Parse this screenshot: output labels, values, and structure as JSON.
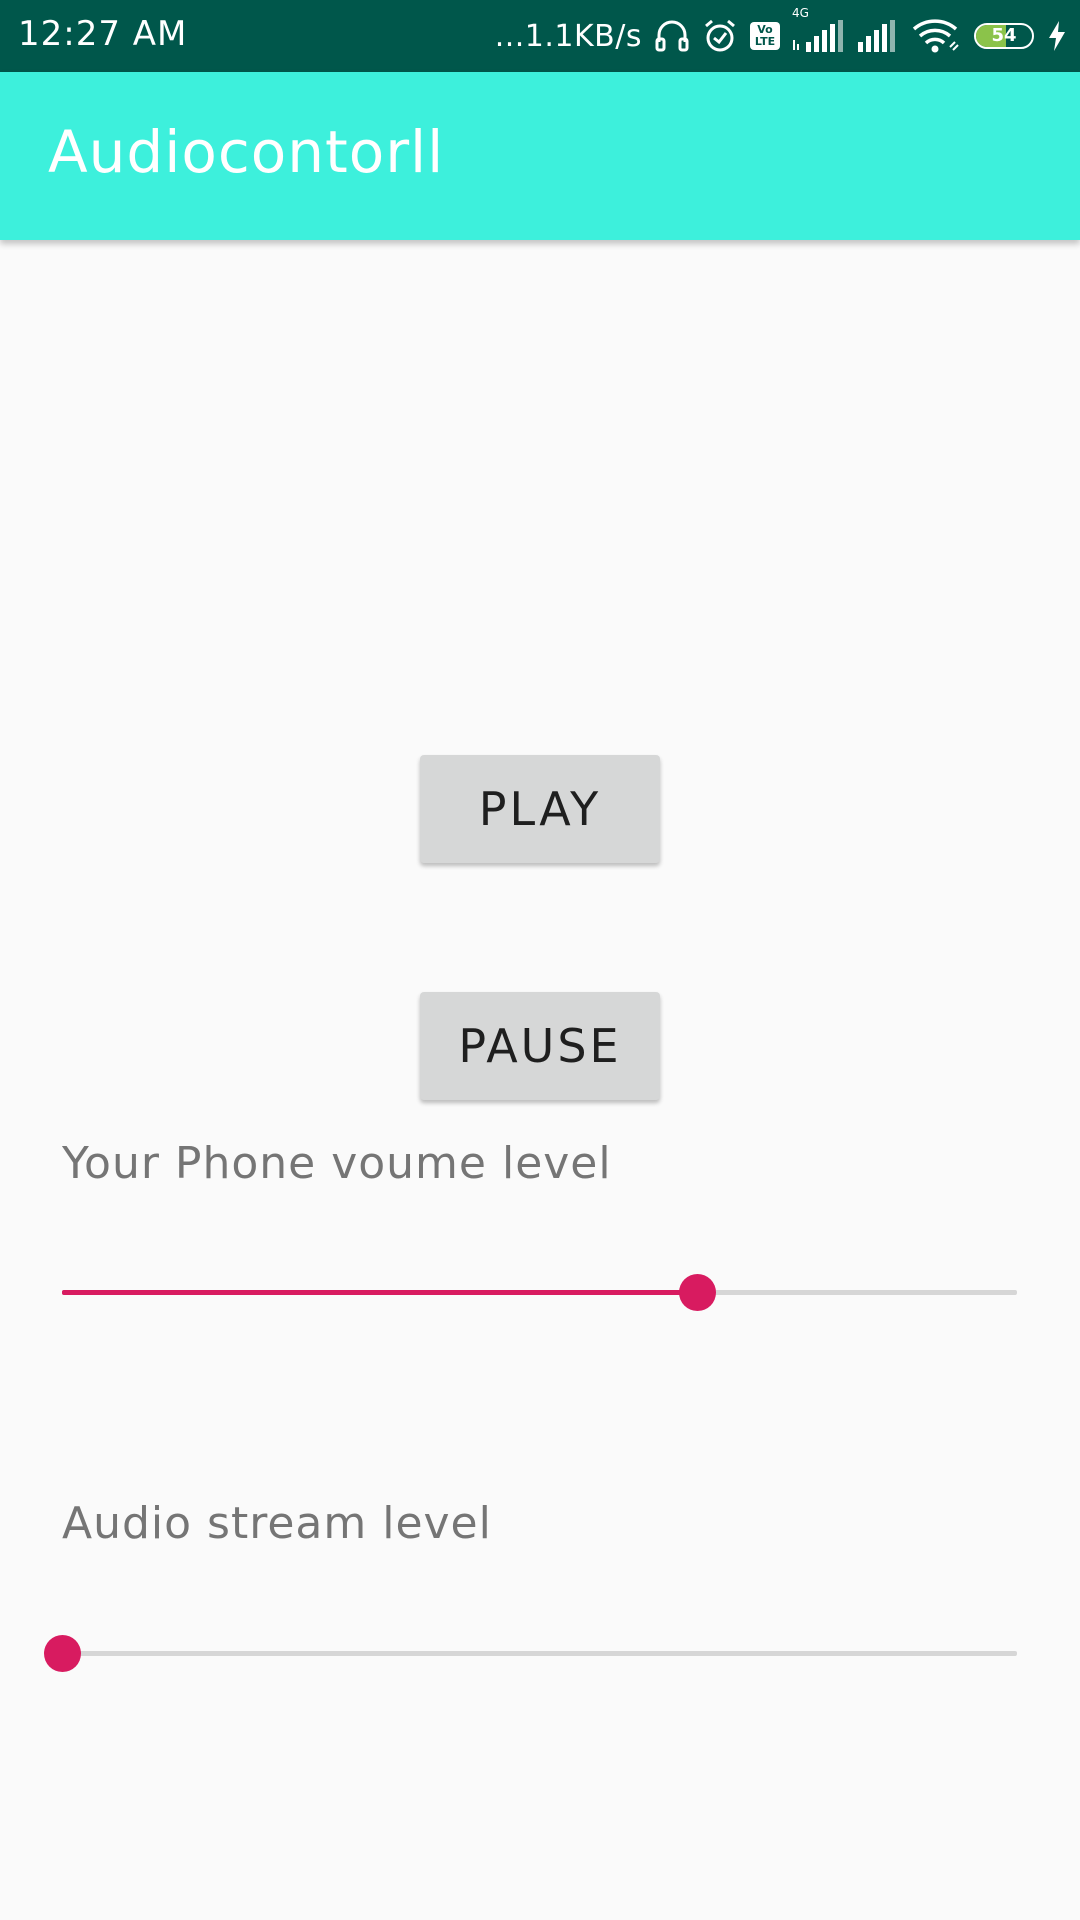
{
  "status_bar": {
    "time": "12:27 AM",
    "network_speed": "...1.1KB/s",
    "icons": [
      "headphones-icon",
      "alarm-icon",
      "volte-icon",
      "signal-4g-icon",
      "signal-icon",
      "wifi-icon",
      "battery-icon",
      "charging-icon"
    ],
    "volte_top": "Vo",
    "volte_bottom": "LTE",
    "network_type": "4G",
    "battery_level": "54",
    "battery_fraction": 0.54
  },
  "app_bar": {
    "title": "Audiocontorll",
    "background_color": "#3df0dc"
  },
  "buttons": {
    "play_label": "PLAY",
    "pause_label": "PAUSE"
  },
  "volume": {
    "label": "Your Phone voume level",
    "value_fraction": 0.665
  },
  "stream": {
    "label": "Audio stream level",
    "value_fraction": 0.0
  },
  "colors": {
    "status_bar": "#00574b",
    "accent": "#d81b60",
    "button_bg": "#d6d7d7"
  }
}
